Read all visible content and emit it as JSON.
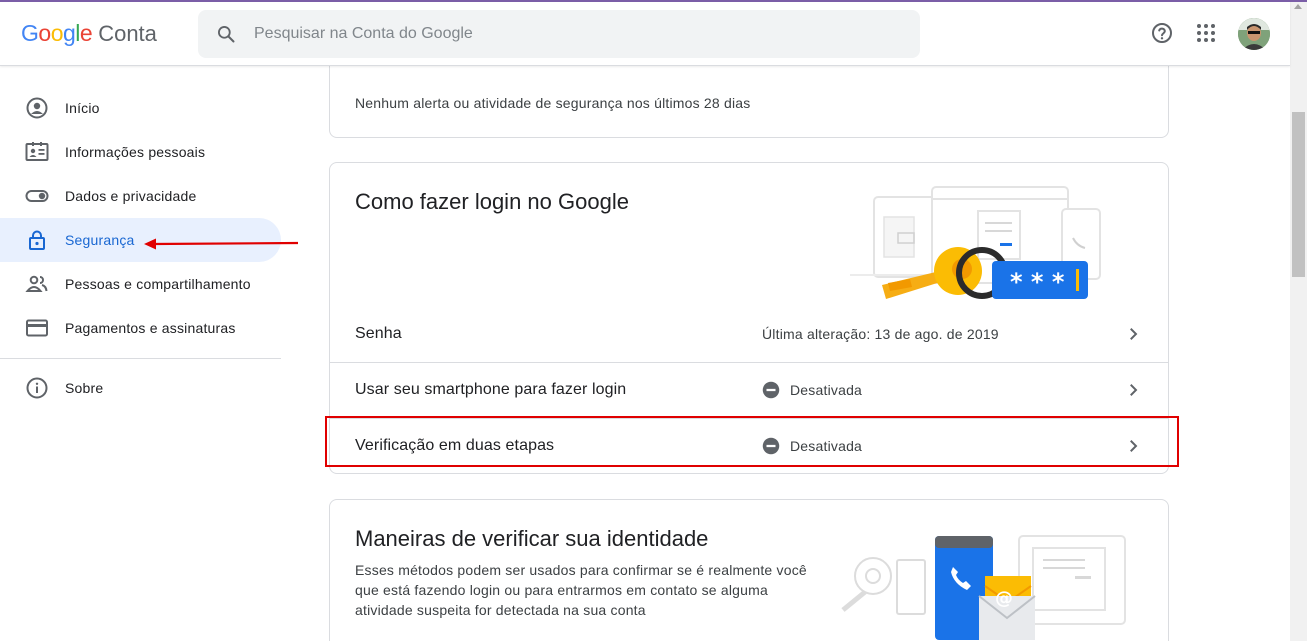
{
  "header": {
    "logo_letters": [
      "G",
      "o",
      "o",
      "g",
      "l",
      "e"
    ],
    "product": "Conta",
    "search_placeholder": "Pesquisar na Conta do Google",
    "icons": [
      "search-icon",
      "help-icon",
      "apps-grid-icon",
      "avatar"
    ]
  },
  "sidebar": {
    "items": [
      {
        "label": "Início",
        "icon": "account-circle-icon"
      },
      {
        "label": "Informações pessoais",
        "icon": "id-card-icon"
      },
      {
        "label": "Dados e privacidade",
        "icon": "toggle-icon"
      },
      {
        "label": "Segurança",
        "icon": "lock-icon",
        "active": true
      },
      {
        "label": "Pessoas e compartilhamento",
        "icon": "people-icon"
      },
      {
        "label": "Pagamentos e assinaturas",
        "icon": "credit-card-icon"
      },
      {
        "label": "Sobre",
        "icon": "info-icon"
      }
    ]
  },
  "security_events": {
    "text": "Nenhum alerta ou atividade de segurança nos últimos 28 dias"
  },
  "signin": {
    "title": "Como fazer login no Google",
    "rows": [
      {
        "label": "Senha",
        "value": "Última alteração: 13 de ago. de 2019"
      },
      {
        "label": "Usar seu smartphone para fazer login",
        "value": "Desativada"
      },
      {
        "label": "Verificação em duas etapas",
        "value": "Desativada"
      }
    ]
  },
  "verify": {
    "title": "Maneiras de verificar sua identidade",
    "desc": "Esses métodos podem ser usados para confirmar se é realmente você que está fazendo login ou para entrarmos em contato se alguma atividade suspeita for detectada na sua conta"
  },
  "colors": {
    "accent": "#1a73e8",
    "active_bg": "#e8f0fe",
    "annotation_red": "#e00000"
  }
}
